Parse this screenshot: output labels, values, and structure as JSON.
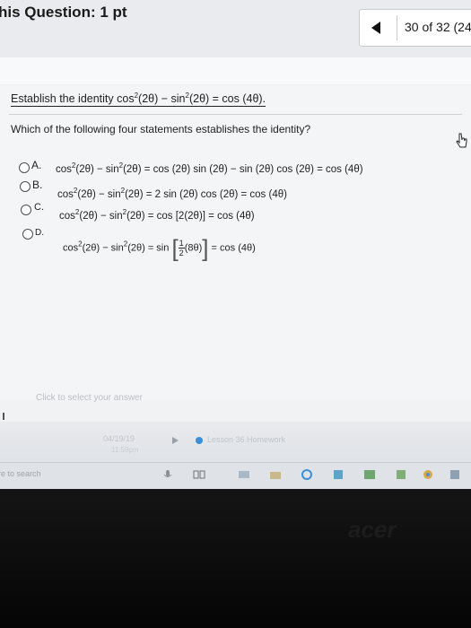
{
  "header": {
    "title": "his Question: 1 pt",
    "counter": "30 of 32 (24"
  },
  "question": {
    "establish_prefix": "Establish the identity cos",
    "establish_mid1": "(2θ) − sin",
    "establish_mid2": "(2θ) = cos (4θ).",
    "exponent": "2",
    "prompt": "Which of the following four statements establishes the identity?"
  },
  "options": [
    {
      "letter": "A.",
      "equation": "(2θ) − sin",
      "equation2": "(2θ) = cos (2θ) sin (2θ) − sin (2θ) cos (2θ) = cos (4θ)"
    },
    {
      "letter": "B.",
      "equation": "(2θ) − sin",
      "equation2": "(2θ) = 2 sin (2θ) cos (2θ) = cos (4θ)"
    },
    {
      "letter": "C.",
      "equation": "(2θ) − sin",
      "equation2": "(2θ) = cos [2(2θ)] = cos (4θ)"
    },
    {
      "letter": "D.",
      "equation": "(2θ) − sin",
      "equation2": "(2θ) = sin",
      "frac_num": "1",
      "frac_den": "2",
      "inner": "(8θ)",
      "tail": "= cos (4θ)"
    }
  ],
  "cos_label": "cos",
  "hint": "Click to select your answer",
  "footer": {
    "date": "04/19/19",
    "time": "11:59pm",
    "lesson": "Lesson 36 Homework"
  },
  "taskbar": {
    "search": "re to search"
  },
  "bezel": {
    "brand": "acer"
  },
  "colors": {
    "header_bg": "#e9ebee",
    "page_bg": "#f1f2f4",
    "accent_blue": "#3a8fd9"
  }
}
